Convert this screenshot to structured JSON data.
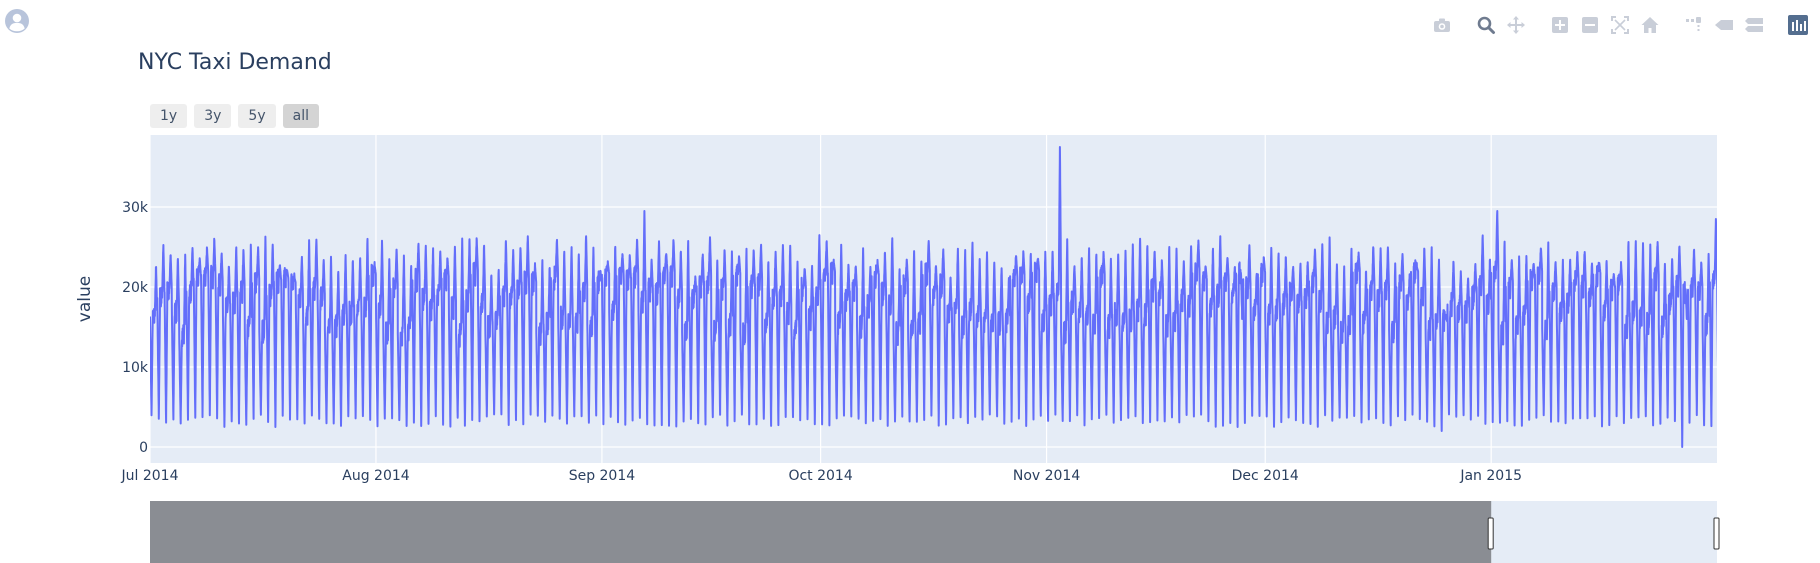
{
  "page": {
    "title": "NYC Taxi Demand"
  },
  "icons": {
    "avatar": "user-avatar-icon",
    "modebar": [
      "camera-icon",
      "zoom-icon",
      "pan-icon",
      "zoom-in-icon",
      "zoom-out-icon",
      "autoscale-icon",
      "reset-axes-icon",
      "spike-lines-icon",
      "hover-closest-icon",
      "hover-compare-icon",
      "plotly-logo-icon"
    ]
  },
  "colors": {
    "line": "#636efa",
    "plot_bg": "#e5ecf6",
    "grid": "#ffffff",
    "text": "#2a3f5f",
    "rangeslider_mask": "#8a8d93",
    "modebar_icon": "#c9ced8",
    "modebar_active": "#6f7b8f"
  },
  "range_selector": {
    "buttons": [
      "1y",
      "3y",
      "5y",
      "all"
    ],
    "active": "all"
  },
  "chart_data": {
    "type": "line",
    "title": "NYC Taxi Demand",
    "xlabel": "",
    "ylabel": "value",
    "xlim": [
      "2014-07-01",
      "2015-01-31"
    ],
    "ylim": [
      -2000,
      39000
    ],
    "x_ticks": [
      "Jul 2014",
      "Aug 2014",
      "Sep 2014",
      "Oct 2014",
      "Nov 2014",
      "Dec 2014",
      "Jan 2015"
    ],
    "y_ticks": [
      "0",
      "10k",
      "20k",
      "30k"
    ],
    "y_tick_values": [
      0,
      10000,
      20000,
      30000
    ],
    "grid": true,
    "series": [
      {
        "name": "",
        "sampling": "half-hourly",
        "daily_min": 2500,
        "daily_max_typical": 25500,
        "weekday_band": [
          14000,
          22000
        ],
        "spikes": [
          {
            "x": "2014-09-06",
            "value": 29500
          },
          {
            "x": "2014-11-02",
            "value": 37500
          },
          {
            "x": "2015-01-01",
            "value": 29500
          },
          {
            "x": "2015-01-31",
            "value": 28500
          }
        ],
        "dips": [
          {
            "x": "2014-11-27",
            "value": 2500
          },
          {
            "x": "2014-12-25",
            "value": 2000
          },
          {
            "x": "2015-01-27",
            "value": 0
          }
        ]
      }
    ],
    "rangeslider": {
      "visible": true,
      "selected_range": [
        "2015-01-01",
        "2015-01-31"
      ]
    }
  }
}
